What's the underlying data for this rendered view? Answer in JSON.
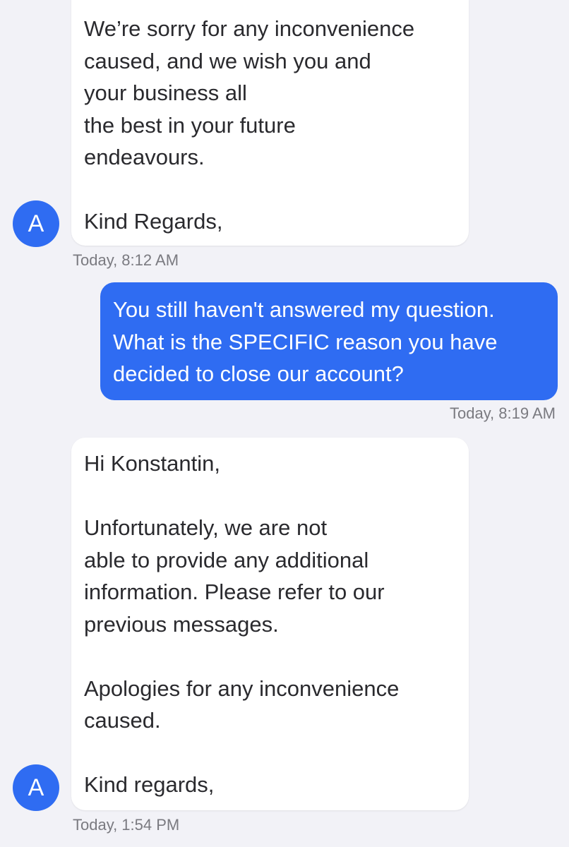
{
  "conversation": {
    "messages": [
      {
        "direction": "incoming",
        "avatar_letter": "A",
        "lines": [
          "We’re sorry for any inconvenience",
          "caused, and we wish you and",
          "your business all",
          "the best in your future",
          "endeavours.",
          "",
          "Kind Regards,"
        ],
        "timestamp": "Today, 8:12 AM"
      },
      {
        "direction": "outgoing",
        "lines": [
          "You still haven't answered my question.",
          "What is the SPECIFIC reason you have",
          "decided to close our account?"
        ],
        "timestamp": "Today, 8:19 AM"
      },
      {
        "direction": "incoming",
        "avatar_letter": "A",
        "lines": [
          "Hi Konstantin,",
          "",
          "Unfortunately, we are not",
          "able to provide any additional",
          "information. Please refer to our",
          "previous messages.",
          "",
          "Apologies for any inconvenience",
          "caused.",
          "",
          "Kind regards,"
        ],
        "timestamp": "Today, 1:54 PM"
      }
    ]
  },
  "colors": {
    "background": "#f2f2f7",
    "incoming_bubble": "#ffffff",
    "outgoing_bubble": "#2f6cf2",
    "avatar": "#2f6cf2",
    "timestamp_text": "#7a7a80"
  }
}
